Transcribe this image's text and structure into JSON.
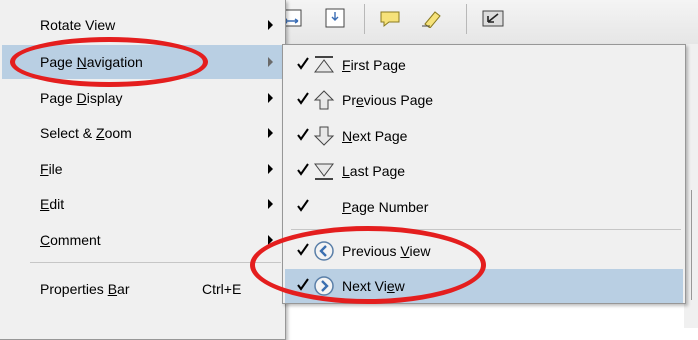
{
  "main_menu": {
    "items": [
      {
        "label": "Rotate View",
        "underline_index": null,
        "shortcut": "",
        "has_submenu": true,
        "highlighted": false
      },
      {
        "label": "Page Navigation",
        "underline_index": 5,
        "shortcut": "",
        "has_submenu": true,
        "highlighted": true
      },
      {
        "label": "Page Display",
        "underline_index": 5,
        "shortcut": "",
        "has_submenu": true,
        "highlighted": false
      },
      {
        "label": "Select & Zoom",
        "underline_index": 9,
        "shortcut": "",
        "has_submenu": true,
        "highlighted": false
      },
      {
        "label": "File",
        "underline_index": 0,
        "shortcut": "",
        "has_submenu": true,
        "highlighted": false
      },
      {
        "label": "Edit",
        "underline_index": 0,
        "shortcut": "",
        "has_submenu": true,
        "highlighted": false
      },
      {
        "label": "Comment",
        "underline_index": 0,
        "shortcut": "",
        "has_submenu": true,
        "highlighted": false
      },
      {
        "label": "Properties Bar",
        "underline_index": 11,
        "shortcut": "Ctrl+E",
        "has_submenu": false,
        "highlighted": false
      }
    ]
  },
  "submenu": {
    "items": [
      {
        "label": "First Page",
        "underline_index": 0,
        "checked": true,
        "icon": "first-page-icon",
        "highlighted": false
      },
      {
        "label": "Previous Page",
        "underline_index": 2,
        "checked": true,
        "icon": "previous-page-icon",
        "highlighted": false
      },
      {
        "label": "Next Page",
        "underline_index": 0,
        "checked": true,
        "icon": "next-page-icon",
        "highlighted": false
      },
      {
        "label": "Last Page",
        "underline_index": 0,
        "checked": true,
        "icon": "last-page-icon",
        "highlighted": false
      },
      {
        "label": "Page Number",
        "underline_index": 0,
        "checked": true,
        "icon": "",
        "highlighted": false
      },
      {
        "label": "Previous View",
        "underline_index": 9,
        "checked": true,
        "icon": "previous-view-icon",
        "highlighted": false
      },
      {
        "label": "Next View",
        "underline_index": 7,
        "checked": true,
        "icon": "next-view-icon",
        "highlighted": true
      }
    ]
  },
  "colors": {
    "menu_bg": "#f0f0f0",
    "highlight": "#b9cfe3",
    "annotation_red": "#e41e1e"
  }
}
